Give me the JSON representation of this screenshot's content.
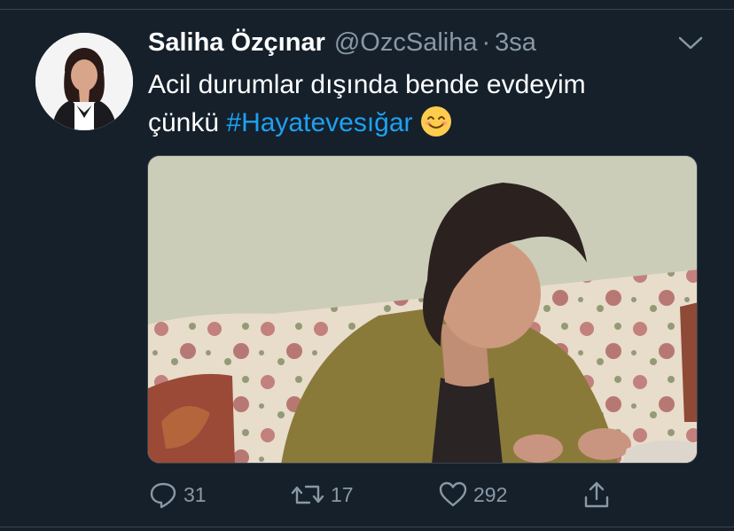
{
  "tweet": {
    "author_name": "Saliha Özçınar",
    "handle": "@OzcSaliha",
    "separator": "·",
    "time": "3sa",
    "text_line1": "Acil durumlar dışında bende evdeyim",
    "text_line2_prefix": "çünkü ",
    "hashtag": "#Hayatevesığar",
    "emoji_icon": "smiling-face-emoji"
  },
  "actions": {
    "replies": "31",
    "retweets": "17",
    "likes": "292"
  },
  "colors": {
    "background": "#15202b",
    "secondary_text": "#8899a6",
    "link": "#1da1f2",
    "divider": "#38444d"
  }
}
